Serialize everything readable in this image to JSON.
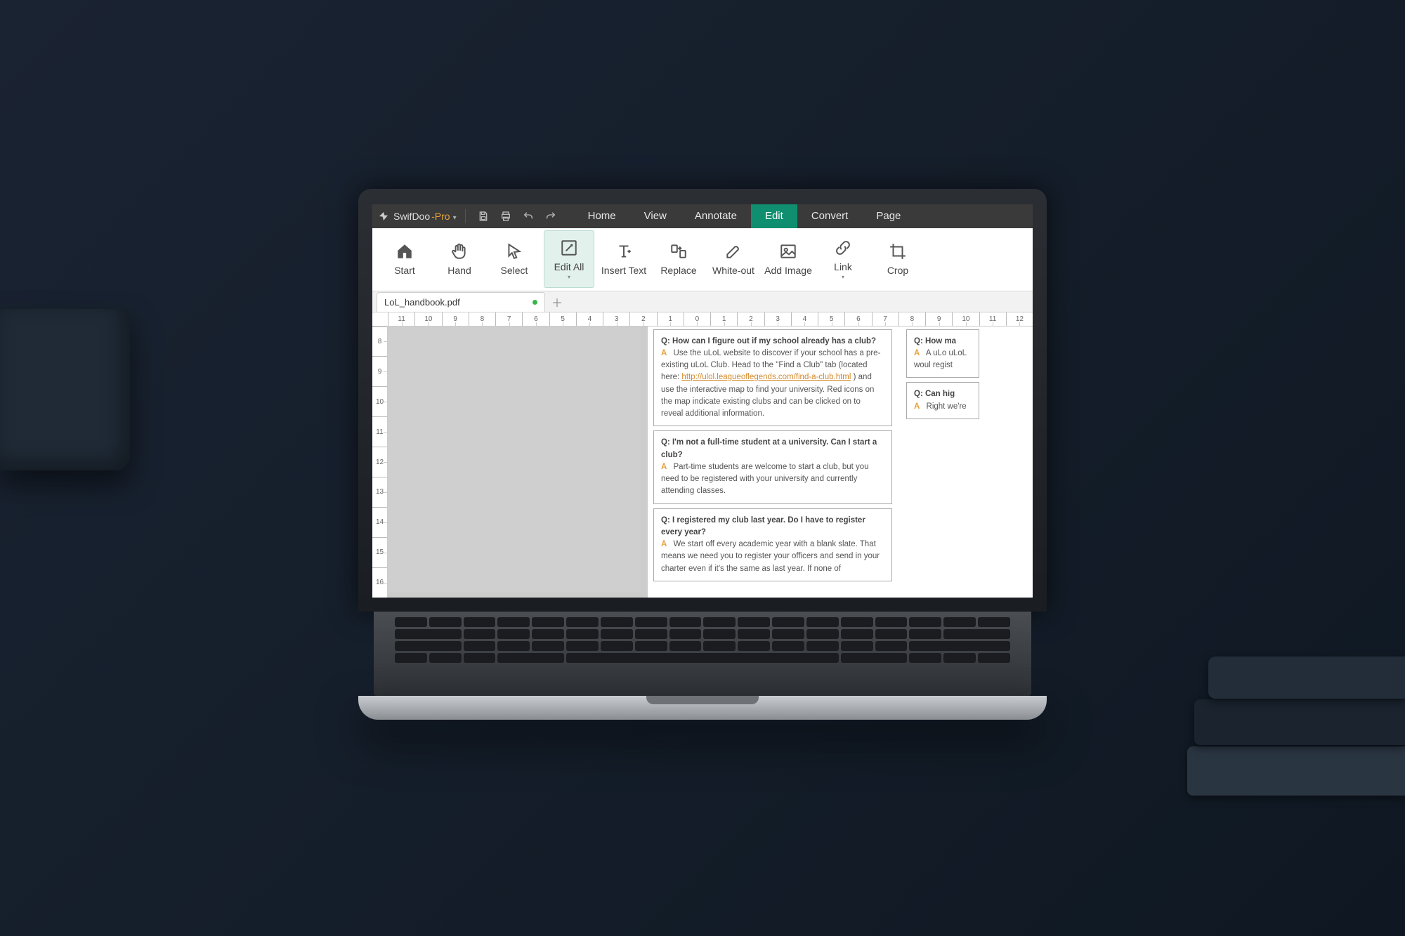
{
  "app": {
    "name_prefix": "SwifDoo",
    "name_suffix": "-Pro"
  },
  "menu": {
    "items": [
      "Home",
      "View",
      "Annotate",
      "Edit",
      "Convert",
      "Page"
    ],
    "active_index": 3
  },
  "ribbon": {
    "tools": [
      {
        "id": "start",
        "label": "Start"
      },
      {
        "id": "hand",
        "label": "Hand"
      },
      {
        "id": "select",
        "label": "Select"
      },
      {
        "id": "editall",
        "label": "Edit All",
        "active": true,
        "dropdown": true
      },
      {
        "id": "inserttext",
        "label": "Insert Text"
      },
      {
        "id": "replace",
        "label": "Replace"
      },
      {
        "id": "whiteout",
        "label": "White-out"
      },
      {
        "id": "addimage",
        "label": "Add Image"
      },
      {
        "id": "link",
        "label": "Link",
        "dropdown": true
      },
      {
        "id": "crop",
        "label": "Crop"
      }
    ]
  },
  "tabs": {
    "open": [
      {
        "filename": "LoL_handbook.pdf",
        "modified": true
      }
    ]
  },
  "ruler": {
    "horizontal": [
      "11",
      "10",
      "9",
      "8",
      "7",
      "6",
      "5",
      "4",
      "3",
      "2",
      "1",
      "0",
      "1",
      "2",
      "3",
      "4",
      "5",
      "6",
      "7",
      "8",
      "9",
      "10",
      "11",
      "12"
    ],
    "vertical": [
      "8",
      "9",
      "10",
      "11",
      "12",
      "13",
      "14",
      "15",
      "16"
    ]
  },
  "document": {
    "faq": [
      {
        "q": "Q: How can I figure out if my school already has a club?",
        "a_pre": "Use the uLoL website to discover if your school has a pre-existing uLoL Club. Head to the \"Find a Club\" tab (located here: ",
        "a_link": "http://ulol.leagueoflegends.com/find-a-club.html",
        "a_post": ") and use the interactive map to find your university. Red icons on the map indicate existing clubs and can be clicked on to reveal additional information."
      },
      {
        "q": "Q: I'm not a full-time student at a university. Can I start a club?",
        "a": "Part-time students are welcome to start a club, but you need to be registered with your university and currently attending classes."
      },
      {
        "q": "Q: I registered my club last year. Do I have to register every year?",
        "a": "We start off every academic year with a blank slate. That means we need you to register your officers and send in your charter even if it's the same as last year. If none of"
      }
    ],
    "side_faq": [
      {
        "q": "Q: How ma",
        "a": "A uLo uLoL woul regist"
      },
      {
        "q": "Q: Can hig",
        "a": "Right we're"
      }
    ]
  }
}
